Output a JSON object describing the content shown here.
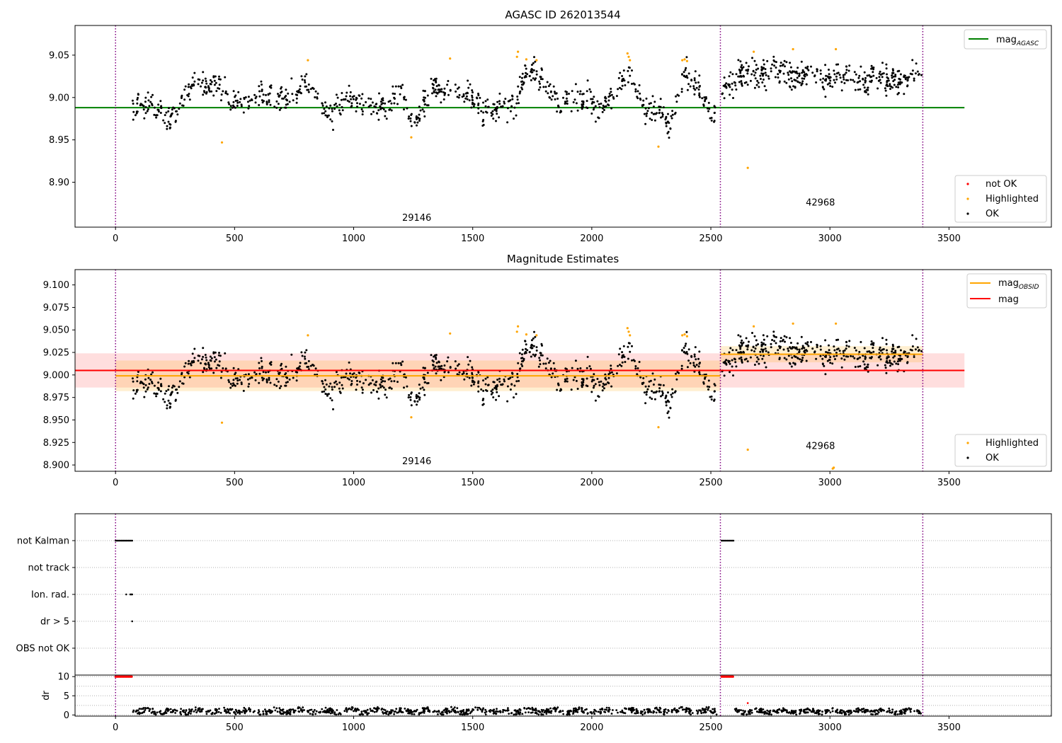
{
  "figure": {
    "colors": {
      "ok": "#000000",
      "highlighted": "#ffa500",
      "not_ok": "#ff0000",
      "mag_agasc_line": "#008000",
      "mag_obsid_line": "#ffa500",
      "mag_line": "#ff0000",
      "obsid_boundary": "#800080",
      "grid": "#b0b0b0"
    }
  },
  "chart_data": [
    {
      "type": "scatter",
      "title": "AGASC ID 262013544",
      "xlim": [
        -170,
        3930
      ],
      "ylim": [
        8.847,
        9.085
      ],
      "x_ticks": [
        0,
        500,
        1000,
        1500,
        2000,
        2500,
        3000,
        3500
      ],
      "x_tick_labels": [
        "0",
        "500",
        "1000",
        "1500",
        "2000",
        "2500",
        "3000",
        "3500"
      ],
      "y_ticks": [
        8.9,
        8.95,
        9.0,
        9.05
      ],
      "y_tick_labels": [
        "8.90",
        "8.95",
        "9.00",
        "9.05"
      ],
      "obsid_boundaries": [
        0,
        2540,
        3390
      ],
      "obsid_labels": [
        {
          "text": "29146",
          "x": 1265,
          "y": 8.858
        },
        {
          "text": "42968",
          "x": 2960,
          "y": 8.876
        }
      ],
      "mag_agasc": {
        "value": 8.988,
        "x_range": [
          -170,
          3565
        ]
      },
      "legend_lines": [
        {
          "name": "mag",
          "sub": "AGASC",
          "color": "#008000"
        }
      ],
      "legend_points": [
        {
          "name": "not OK",
          "color": "#ff0000"
        },
        {
          "name": "Highlighted",
          "color": "#ffa500"
        },
        {
          "name": "OK",
          "color": "#000000"
        }
      ],
      "segments": [
        {
          "obsid": "29146",
          "x_range": [
            70,
            2520
          ],
          "trend": [
            [
              70,
              8.99
            ],
            [
              110,
              8.995
            ],
            [
              160,
              8.985
            ],
            [
              230,
              8.975
            ],
            [
              280,
              9.0
            ],
            [
              330,
              9.015
            ],
            [
              420,
              9.02
            ],
            [
              470,
              8.995
            ],
            [
              560,
              9.0
            ],
            [
              660,
              9.0
            ],
            [
              760,
              9.0
            ],
            [
              820,
              9.025
            ],
            [
              860,
              8.99
            ],
            [
              900,
              8.975
            ],
            [
              980,
              9.005
            ],
            [
              1050,
              8.99
            ],
            [
              1150,
              8.99
            ],
            [
              1200,
              9.005
            ],
            [
              1250,
              8.965
            ],
            [
              1280,
              8.99
            ],
            [
              1350,
              9.01
            ],
            [
              1420,
              9.005
            ],
            [
              1500,
              8.995
            ],
            [
              1600,
              8.985
            ],
            [
              1670,
              8.99
            ],
            [
              1720,
              9.03
            ],
            [
              1800,
              9.02
            ],
            [
              1870,
              8.995
            ],
            [
              1940,
              9.0
            ],
            [
              2000,
              9.0
            ],
            [
              2040,
              8.98
            ],
            [
              2120,
              9.02
            ],
            [
              2160,
              9.03
            ],
            [
              2220,
              8.98
            ],
            [
              2280,
              8.99
            ],
            [
              2330,
              8.965
            ],
            [
              2390,
              9.03
            ],
            [
              2450,
              9.01
            ],
            [
              2500,
              8.975
            ],
            [
              2520,
              8.985
            ]
          ],
          "noise": 0.007,
          "n": 900
        },
        {
          "obsid": "42968",
          "x_range": [
            2545,
            3385
          ],
          "trend": [
            [
              2545,
              9.015
            ],
            [
              2700,
              9.03
            ],
            [
              2900,
              9.025
            ],
            [
              3100,
              9.025
            ],
            [
              3250,
              9.02
            ],
            [
              3385,
              9.025
            ]
          ],
          "noise": 0.008,
          "n": 380
        }
      ],
      "highlighted_points": [
        [
          447,
          8.947
        ],
        [
          808,
          9.044
        ],
        [
          1242,
          8.953
        ],
        [
          1405,
          9.046
        ],
        [
          1690,
          9.054
        ],
        [
          1686,
          9.048
        ],
        [
          1725,
          9.045
        ],
        [
          1768,
          9.044
        ],
        [
          2150,
          9.052
        ],
        [
          2155,
          9.048
        ],
        [
          2160,
          9.044
        ],
        [
          2280,
          8.942
        ],
        [
          2380,
          9.044
        ],
        [
          2390,
          9.045
        ],
        [
          2400,
          9.043
        ],
        [
          2655,
          8.917
        ],
        [
          2680,
          9.054
        ],
        [
          2845,
          9.057
        ],
        [
          3025,
          9.057
        ]
      ],
      "not_ok_points": []
    },
    {
      "type": "scatter",
      "title": "Magnitude Estimates",
      "xlim": [
        -170,
        3930
      ],
      "ylim": [
        8.893,
        9.117
      ],
      "x_ticks": [
        0,
        500,
        1000,
        1500,
        2000,
        2500,
        3000,
        3500
      ],
      "x_tick_labels": [
        "0",
        "500",
        "1000",
        "1500",
        "2000",
        "2500",
        "3000",
        "3500"
      ],
      "y_ticks": [
        8.9,
        8.925,
        8.95,
        8.975,
        9.0,
        9.025,
        9.05,
        9.075,
        9.1
      ],
      "y_tick_labels": [
        "8.900",
        "8.925",
        "8.950",
        "8.975",
        "9.000",
        "9.025",
        "9.050",
        "9.075",
        "9.100"
      ],
      "obsid_boundaries": [
        0,
        2540,
        3390
      ],
      "obsid_labels": [
        {
          "text": "29146",
          "x": 1265,
          "y": 8.904
        },
        {
          "text": "42968",
          "x": 2960,
          "y": 8.921
        }
      ],
      "mag": {
        "value": 9.005,
        "band": [
          8.986,
          9.024
        ],
        "x_range": [
          -170,
          3565
        ]
      },
      "mag_obsid": [
        {
          "value": 8.999,
          "band": [
            8.982,
            9.016
          ],
          "x_range": [
            0,
            2540
          ]
        },
        {
          "value": 9.023,
          "band": [
            9.014,
            9.032
          ],
          "x_range": [
            2540,
            3390
          ]
        }
      ],
      "legend_lines": [
        {
          "name": "mag",
          "sub": "OBSID",
          "color": "#ffa500"
        },
        {
          "name": "mag",
          "sub": "",
          "color": "#ff0000"
        }
      ],
      "legend_points": [
        {
          "name": "Highlighted",
          "color": "#ffa500"
        },
        {
          "name": "OK",
          "color": "#000000"
        }
      ],
      "highlighted_points": [
        [
          447,
          8.947
        ],
        [
          808,
          9.044
        ],
        [
          1242,
          8.953
        ],
        [
          1405,
          9.046
        ],
        [
          1690,
          9.054
        ],
        [
          1686,
          9.048
        ],
        [
          1725,
          9.045
        ],
        [
          1768,
          9.044
        ],
        [
          2150,
          9.052
        ],
        [
          2155,
          9.048
        ],
        [
          2160,
          9.044
        ],
        [
          2280,
          8.942
        ],
        [
          2380,
          9.044
        ],
        [
          2390,
          9.045
        ],
        [
          2400,
          9.043
        ],
        [
          2655,
          8.917
        ],
        [
          2680,
          9.054
        ],
        [
          2845,
          9.057
        ],
        [
          3025,
          9.057
        ],
        [
          3012,
          8.896
        ],
        [
          3016,
          8.897
        ]
      ]
    },
    {
      "type": "scatter",
      "title": "",
      "xlim": [
        -170,
        3930
      ],
      "x_ticks": [
        0,
        500,
        1000,
        1500,
        2000,
        2500,
        3000,
        3500
      ],
      "x_tick_labels": [
        "0",
        "500",
        "1000",
        "1500",
        "2000",
        "2500",
        "3000",
        "3500"
      ],
      "flag_rows": [
        "not Kalman",
        "not track",
        "Ion. rad.",
        "dr > 5",
        "OBS not OK"
      ],
      "flag_points": [
        {
          "row": "not Kalman",
          "x_range": [
            0,
            70
          ],
          "color": "#000000"
        },
        {
          "row": "not Kalman",
          "x_range": [
            2545,
            2595
          ],
          "color": "#000000"
        },
        {
          "row": "Ion. rad.",
          "points": [
            45,
            62,
            66,
            70
          ],
          "color": "#000000"
        },
        {
          "row": "dr > 5",
          "points": [
            70
          ],
          "color": "#000000"
        }
      ],
      "obsid_boundaries": [
        0,
        2540,
        3390
      ]
    },
    {
      "type": "scatter",
      "title": "",
      "xlim": [
        -170,
        3930
      ],
      "ylim": [
        -0.3,
        10.4
      ],
      "ylabel": "dr",
      "y_ticks": [
        0,
        5,
        10
      ],
      "y_tick_labels": [
        "0",
        "5",
        "10"
      ],
      "x_ticks": [
        0,
        500,
        1000,
        1500,
        2000,
        2500,
        3000,
        3500
      ],
      "x_tick_labels": [
        "0",
        "500",
        "1000",
        "1500",
        "2000",
        "2500",
        "3000",
        "3500"
      ],
      "obsid_boundaries": [
        0,
        2540,
        3390
      ],
      "clipped_points": [
        {
          "x_range": [
            0,
            70
          ],
          "y": 10,
          "color": "#ff0000"
        },
        {
          "x_range": [
            2545,
            2595
          ],
          "y": 10,
          "color": "#ff0000"
        }
      ],
      "red_points": [
        [
          2655,
          3.1
        ]
      ],
      "dr_series": [
        {
          "x_range": [
            70,
            2525
          ],
          "mean": 1.0,
          "spread": 0.75,
          "n": 900
        },
        {
          "x_range": [
            2600,
            3385
          ],
          "mean": 0.9,
          "spread": 0.6,
          "n": 320
        }
      ]
    }
  ]
}
